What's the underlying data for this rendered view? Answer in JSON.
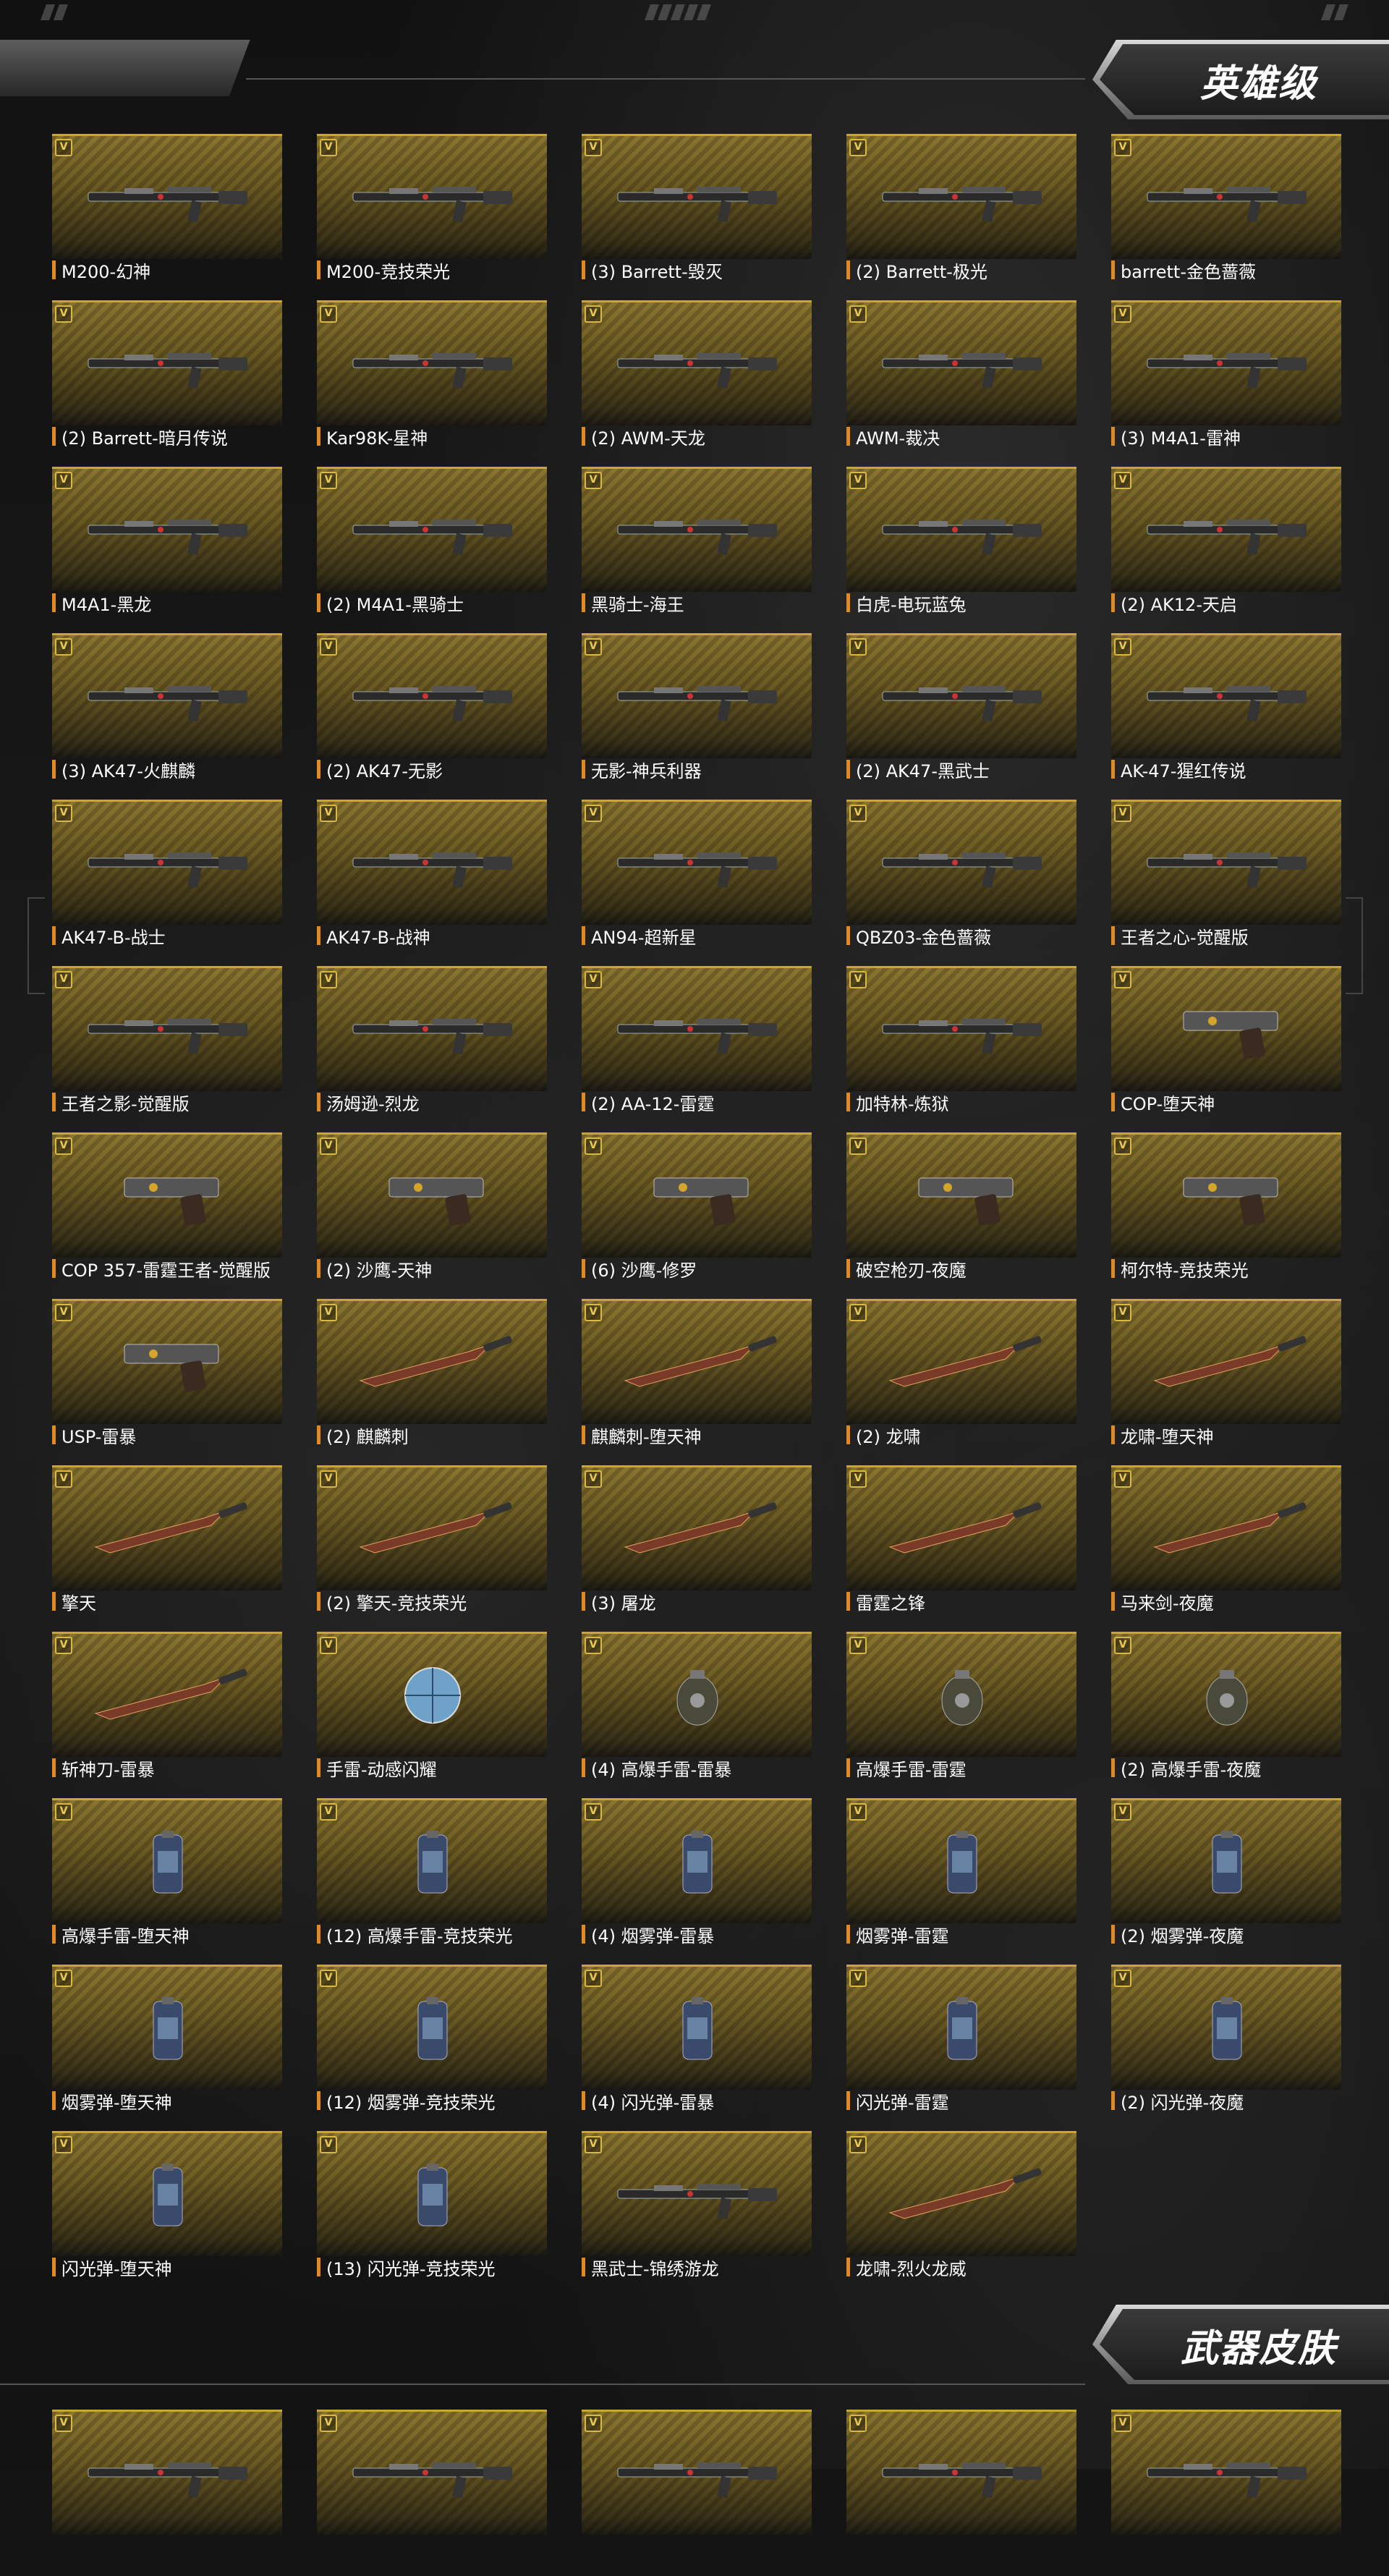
{
  "sections": {
    "hero_title": "英雄级",
    "skin_title": "武器皮肤"
  },
  "items": [
    {
      "name": "M200-幻神",
      "kind": "rifle"
    },
    {
      "name": "M200-竞技荣光",
      "kind": "rifle"
    },
    {
      "name": "(3) Barrett-毁灭",
      "kind": "rifle"
    },
    {
      "name": "(2) Barrett-极光",
      "kind": "rifle"
    },
    {
      "name": "barrett-金色蔷薇",
      "kind": "rifle"
    },
    {
      "name": "(2) Barrett-暗月传说",
      "kind": "rifle"
    },
    {
      "name": "Kar98K-星神",
      "kind": "rifle"
    },
    {
      "name": "(2) AWM-天龙",
      "kind": "rifle"
    },
    {
      "name": "AWM-裁决",
      "kind": "rifle"
    },
    {
      "name": "(3) M4A1-雷神",
      "kind": "rifle"
    },
    {
      "name": "M4A1-黑龙",
      "kind": "rifle"
    },
    {
      "name": "(2) M4A1-黑骑士",
      "kind": "rifle"
    },
    {
      "name": "黑骑士-海王",
      "kind": "rifle"
    },
    {
      "name": "白虎-电玩蓝兔",
      "kind": "rifle"
    },
    {
      "name": "(2) AK12-天启",
      "kind": "rifle"
    },
    {
      "name": "(3) AK47-火麒麟",
      "kind": "rifle"
    },
    {
      "name": "(2) AK47-无影",
      "kind": "rifle"
    },
    {
      "name": "无影-神兵利器",
      "kind": "rifle"
    },
    {
      "name": "(2) AK47-黑武士",
      "kind": "rifle"
    },
    {
      "name": "AK-47-猩红传说",
      "kind": "rifle"
    },
    {
      "name": "AK47-B-战士",
      "kind": "rifle"
    },
    {
      "name": "AK47-B-战神",
      "kind": "rifle"
    },
    {
      "name": "AN94-超新星",
      "kind": "rifle"
    },
    {
      "name": "QBZ03-金色蔷薇",
      "kind": "rifle"
    },
    {
      "name": "王者之心-觉醒版",
      "kind": "rifle"
    },
    {
      "name": "王者之影-觉醒版",
      "kind": "rifle"
    },
    {
      "name": "汤姆逊-烈龙",
      "kind": "rifle"
    },
    {
      "name": "(2) AA-12-雷霆",
      "kind": "rifle"
    },
    {
      "name": "加特林-炼狱",
      "kind": "rifle"
    },
    {
      "name": "COP-堕天神",
      "kind": "pistol"
    },
    {
      "name": "COP 357-雷霆王者-觉醒版",
      "kind": "pistol"
    },
    {
      "name": "(2) 沙鹰-天神",
      "kind": "pistol"
    },
    {
      "name": "(6) 沙鹰-修罗",
      "kind": "pistol"
    },
    {
      "name": "破空枪刃-夜魔",
      "kind": "pistol"
    },
    {
      "name": "柯尔特-竞技荣光",
      "kind": "pistol"
    },
    {
      "name": "USP-雷暴",
      "kind": "pistol"
    },
    {
      "name": "(2) 麒麟刺",
      "kind": "melee"
    },
    {
      "name": "麒麟刺-堕天神",
      "kind": "melee"
    },
    {
      "name": "(2) 龙啸",
      "kind": "melee"
    },
    {
      "name": "龙啸-堕天神",
      "kind": "melee"
    },
    {
      "name": "擎天",
      "kind": "melee"
    },
    {
      "name": "(2) 擎天-竞技荣光",
      "kind": "melee"
    },
    {
      "name": "(3) 屠龙",
      "kind": "melee"
    },
    {
      "name": "雷霆之锋",
      "kind": "melee"
    },
    {
      "name": "马来剑-夜魔",
      "kind": "melee"
    },
    {
      "name": "斩神刀-雷暴",
      "kind": "melee"
    },
    {
      "name": "手雷-动感闪耀",
      "kind": "ball"
    },
    {
      "name": "(4) 高爆手雷-雷暴",
      "kind": "grenade"
    },
    {
      "name": "高爆手雷-雷霆",
      "kind": "grenade"
    },
    {
      "name": "(2) 高爆手雷-夜魔",
      "kind": "grenade"
    },
    {
      "name": "高爆手雷-堕天神",
      "kind": "canister"
    },
    {
      "name": "(12) 高爆手雷-竞技荣光",
      "kind": "canister"
    },
    {
      "name": "(4) 烟雾弹-雷暴",
      "kind": "canister"
    },
    {
      "name": "烟雾弹-雷霆",
      "kind": "canister"
    },
    {
      "name": "(2) 烟雾弹-夜魔",
      "kind": "canister"
    },
    {
      "name": "烟雾弹-堕天神",
      "kind": "canister"
    },
    {
      "name": "(12) 烟雾弹-竞技荣光",
      "kind": "canister"
    },
    {
      "name": "(4) 闪光弹-雷暴",
      "kind": "canister"
    },
    {
      "name": "闪光弹-雷霆",
      "kind": "canister"
    },
    {
      "name": "(2) 闪光弹-夜魔",
      "kind": "canister"
    },
    {
      "name": "闪光弹-堕天神",
      "kind": "canister"
    },
    {
      "name": "(13) 闪光弹-竞技荣光",
      "kind": "canister"
    },
    {
      "name": "黑武士-锦绣游龙",
      "kind": "rifle"
    },
    {
      "name": "龙啸-烈火龙威",
      "kind": "melee"
    }
  ],
  "colors": {
    "accent_bar": "#e38a1e",
    "card_gold": "#8a7530",
    "card_border": "#c9a43a"
  }
}
